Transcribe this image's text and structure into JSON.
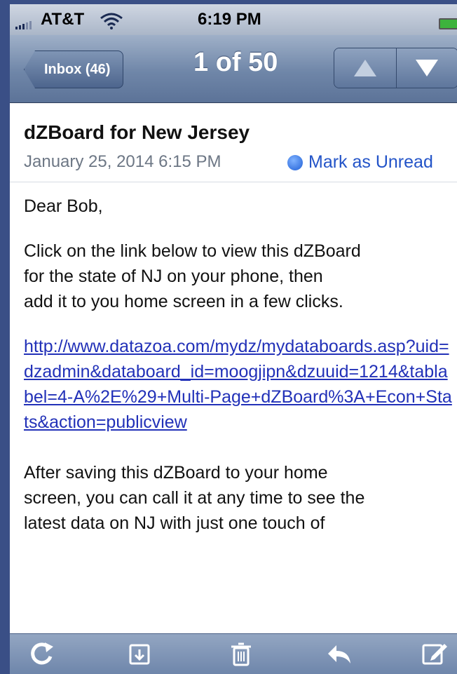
{
  "status_bar": {
    "carrier": "AT&T",
    "time": "6:19 PM"
  },
  "nav": {
    "back_label": "Inbox (46)",
    "position": "1 of 50"
  },
  "message": {
    "subject": "dZBoard for New Jersey",
    "date": "January 25, 2014 6:15 PM",
    "mark_unread": "Mark as Unread",
    "greeting": "Dear Bob,",
    "paragraph1_lines": [
      "Click on the link below to view this dZBoard",
      "for the state of  NJ  on your phone, then",
      "add it to you home screen in a few clicks."
    ],
    "link": "http://www.datazoa.com/mydz/mydataboards.asp?uid=dzadmin&databoard_id=moogjipn&dzuuid=1214&tablabel=4-A%2E%29+Multi-Page+dZBoard%3A+Econ+Stats&action=publicview",
    "paragraph2_lines": [
      "After saving this dZBoard to your home",
      "screen, you can call it at any time to see the",
      "latest data on NJ  with just one touch of"
    ]
  },
  "icons": {
    "refresh": "refresh-icon",
    "folder": "folder-move-icon",
    "trash": "trash-icon",
    "reply": "reply-icon",
    "compose": "compose-icon"
  },
  "colors": {
    "link": "#2231b8",
    "mark_unread": "#2354c8",
    "nav_bar": "#6f86a8"
  }
}
